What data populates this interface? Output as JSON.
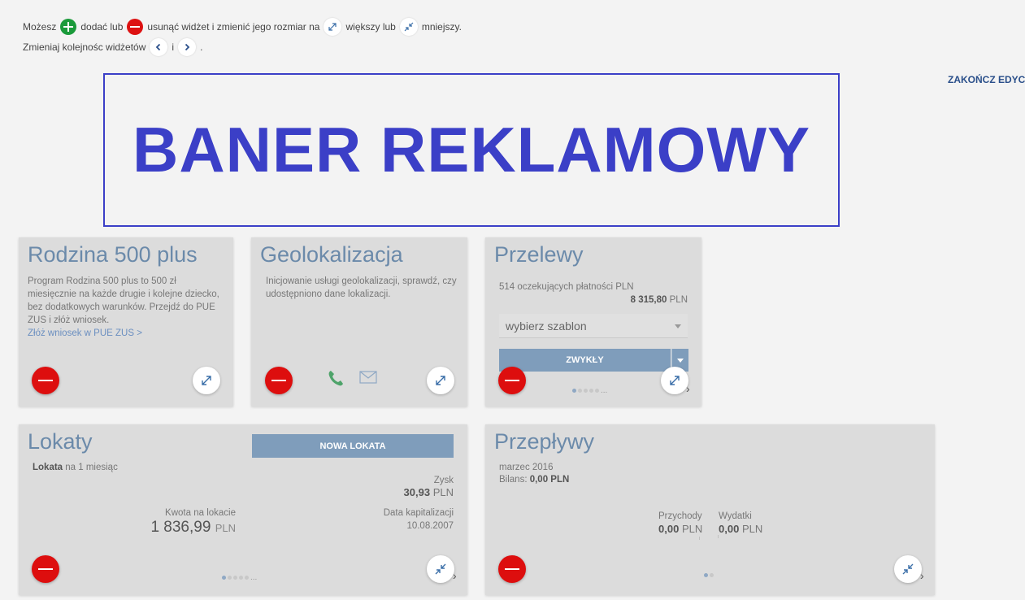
{
  "instructions": {
    "line1_a": "Możesz",
    "line1_b": "dodać lub",
    "line1_c": "usunąć widżet i zmienić jego rozmiar na",
    "line1_d": "większy lub",
    "line1_e": "mniejszy.",
    "line2_a": "Zmieniaj kolejnośc widżetów",
    "line2_b": "i",
    "line2_c": "."
  },
  "end_edit_label": "ZAKOŃCZ EDYCJĘ",
  "banner_text": "BANER REKLAMOWY",
  "widgets": {
    "rodzina": {
      "title": "Rodzina 500 plus",
      "description": "Program Rodzina 500 plus to 500 zł miesięcznie na każde drugie i kolejne dziecko, bez dodatkowych warunków. Przejdź do PUE ZUS i złóż wniosek.",
      "link": "Złóż wniosek w PUE ZUS >"
    },
    "geo": {
      "title": "Geolokalizacja",
      "description": "Inicjowanie usługi geolokalizacji, sprawdź, czy udostępniono dane lokalizacji."
    },
    "przelewy": {
      "title": "Przelewy",
      "pending": "514 oczekujących płatności PLN",
      "amount": "8 315,80",
      "currency": "PLN",
      "select_placeholder": "wybierz szablon",
      "button_label": "ZWYKŁY",
      "dots_more": "..."
    },
    "lokaty": {
      "title": "Lokaty",
      "new_button": "NOWA LOKATA",
      "subtitle_bold": "Lokata",
      "subtitle_rest": " na 1 miesiąc",
      "zysk_label": "Zysk",
      "zysk_value": "30,93",
      "currency": "PLN",
      "kwota_label": "Kwota na lokacie",
      "kwota_value": "1 836,99",
      "data_label": "Data kapitalizacji",
      "data_value": "10.08.2007",
      "dots_more": "..."
    },
    "przeplywy": {
      "title": "Przepływy",
      "month": "marzec 2016",
      "bilans_label": "Bilans: ",
      "bilans_value": "0,00 PLN",
      "przychody_label": "Przychody",
      "przychody_value": "0,00",
      "wydatki_label": "Wydatki",
      "wydatki_value": "0,00",
      "currency": "PLN"
    }
  },
  "colors": {
    "accent_blue": "#3b3fc7",
    "title_blue": "#6b8aaa",
    "remove_red": "#dd0e0e",
    "add_green": "#1a9a3a",
    "button_blue": "#7f9dbb"
  }
}
